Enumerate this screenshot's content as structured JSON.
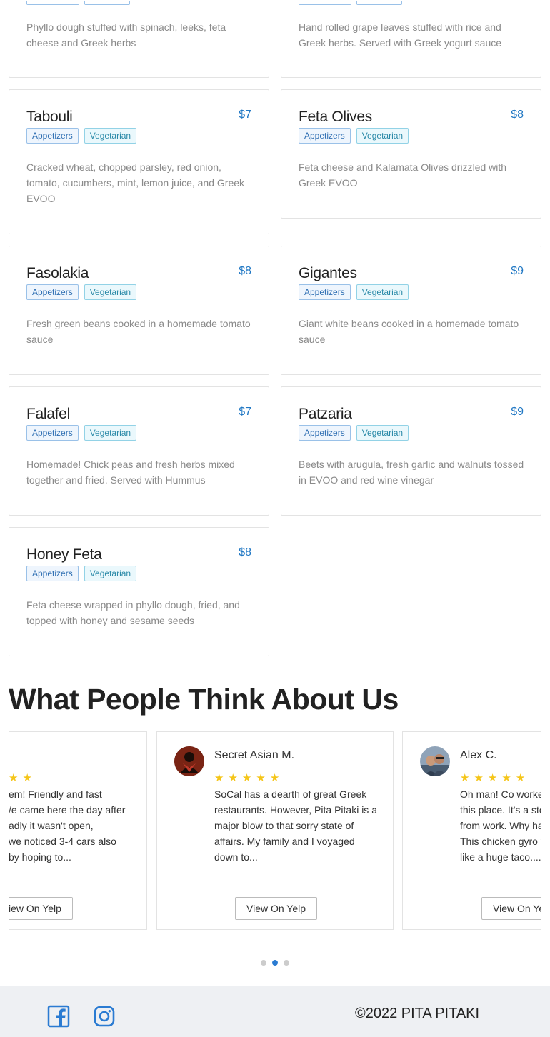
{
  "menu_items": [
    {
      "name": "Tabouli",
      "price": "$7",
      "tags": [
        "Appetizers",
        "Vegetarian"
      ],
      "description": "Cracked wheat, chopped parsley, red onion, tomato, cucumbers, mint, lemon juice, and Greek EVOO"
    },
    {
      "name": "Feta Olives",
      "price": "$8",
      "tags": [
        "Appetizers",
        "Vegetarian"
      ],
      "description": "Feta cheese and Kalamata Olives drizzled with Greek EVOO"
    },
    {
      "name": "Fasolakia",
      "price": "$8",
      "tags": [
        "Appetizers",
        "Vegetarian"
      ],
      "description": "Fresh green beans cooked in a homemade tomato sauce"
    },
    {
      "name": "Gigantes",
      "price": "$9",
      "tags": [
        "Appetizers",
        "Vegetarian"
      ],
      "description": "Giant white beans cooked in a homemade tomato sauce"
    },
    {
      "name": "Falafel",
      "price": "$7",
      "tags": [
        "Appetizers",
        "Vegetarian"
      ],
      "description": "Homemade! Chick peas and fresh herbs mixed together and fried. Served with Hummus"
    },
    {
      "name": "Patzaria",
      "price": "$9",
      "tags": [
        "Appetizers",
        "Vegetarian"
      ],
      "description": "Beets with arugula, fresh garlic and walnuts tossed in EVOO and red wine vinegar"
    },
    {
      "name": "Honey Feta",
      "price": "$8",
      "tags": [
        "Appetizers",
        "Vegetarian"
      ],
      "description": "Feta cheese wrapped in phyllo dough, fried, and topped with honey and sesame seeds"
    }
  ],
  "partial_top": {
    "left_description": "Phyllo dough stuffed with spinach, leeks, feta cheese and Greek herbs",
    "right_description": "Hand rolled grape leaves stuffed with rice and Greek herbs. Served with Greek yogurt sauce"
  },
  "reviews": {
    "title": "What People Think About Us",
    "items": [
      {
        "reviewer": "",
        "rating": 5,
        "text_lines": [
          "em! Friendly and fast",
          "/e came here the day after",
          "adly it wasn't open,",
          "we noticed 3-4 cars also",
          "by hoping to..."
        ],
        "button": "iew On Yelp"
      },
      {
        "reviewer": "Secret Asian M.",
        "rating": 5,
        "text": "SoCal has a dearth of great Greek restaurants. However, Pita Pitaki is a major blow to that sorry state of affairs. My family and I voyaged down to...",
        "button": "View On Yelp"
      },
      {
        "reviewer": "Alex C.",
        "rating": 5,
        "text_lines": [
          "Oh man! Co worker",
          "this place. It's a sto",
          "from work. Why ha",
          "This chicken gyro w",
          "like a huge taco...."
        ],
        "button": "View On Ye"
      }
    ],
    "active_slide": 2,
    "slide_count": 3
  },
  "footer": {
    "copyright": "©2022 PITA PITAKI",
    "icons": [
      "facebook-icon",
      "instagram-icon"
    ],
    "icon_color": "#2a7bd2"
  },
  "colors": {
    "price": "#2178c4",
    "star": "#f5c518",
    "footer_bg": "#eef0f3"
  }
}
